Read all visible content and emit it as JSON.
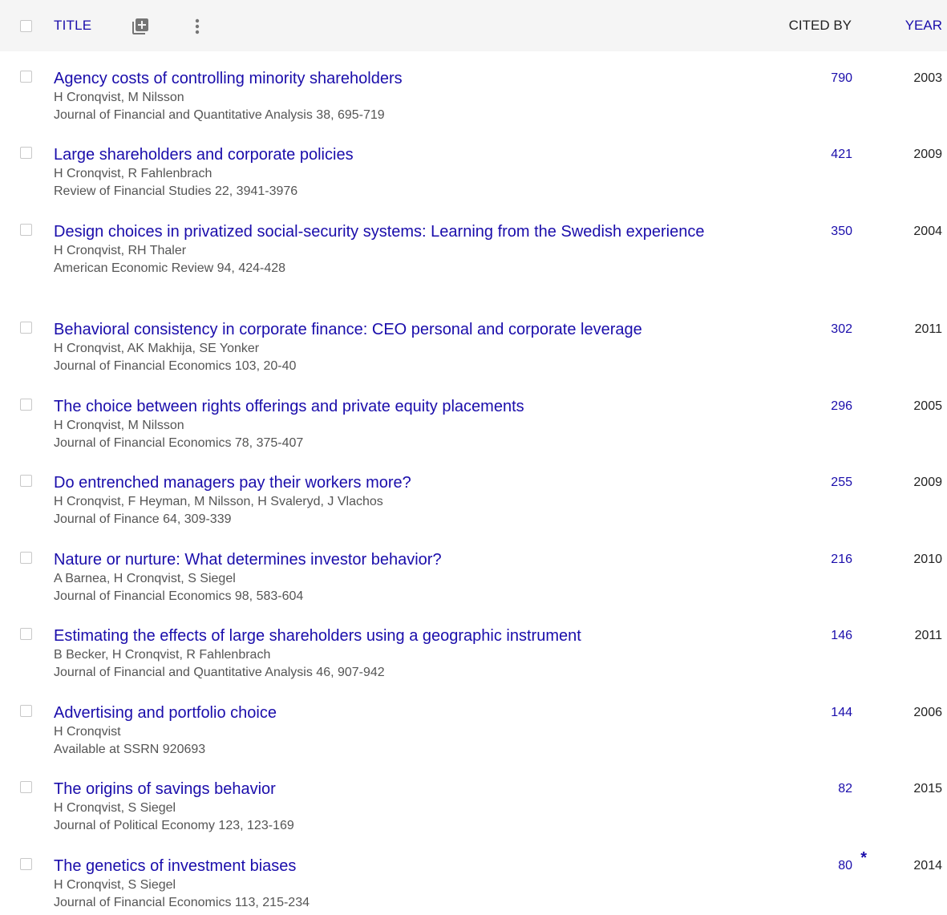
{
  "header": {
    "title_label": "TITLE",
    "cited_by_label": "CITED BY",
    "year_label": "YEAR",
    "icons": [
      "add-to-library-icon",
      "more-vert-icon"
    ]
  },
  "colors": {
    "link": "#1a0dab",
    "meta_text": "#555555",
    "header_bg": "#f5f5f5"
  },
  "articles": [
    {
      "title": "Agency costs of controlling minority shareholders",
      "authors": "H Cronqvist, M Nilsson",
      "venue": "Journal of Financial and Quantitative Analysis 38, 695-719",
      "cited_by": "790",
      "year": "2003",
      "star": ""
    },
    {
      "title": "Large shareholders and corporate policies",
      "authors": "H Cronqvist, R Fahlenbrach",
      "venue": "Review of Financial Studies 22, 3941-3976",
      "cited_by": "421",
      "year": "2009",
      "star": ""
    },
    {
      "title": "Design choices in privatized social-security systems: Learning from the Swedish experience",
      "authors": "H Cronqvist, RH Thaler",
      "venue": "American Economic Review 94, 424-428",
      "cited_by": "350",
      "year": "2004",
      "star": ""
    },
    {
      "title": "Behavioral consistency in corporate finance: CEO personal and corporate leverage",
      "authors": "H Cronqvist, AK Makhija, SE Yonker",
      "venue": "Journal of Financial Economics 103, 20-40",
      "cited_by": "302",
      "year": "2011",
      "star": ""
    },
    {
      "title": "The choice between rights offerings and private equity placements",
      "authors": "H Cronqvist, M Nilsson",
      "venue": "Journal of Financial Economics 78, 375-407",
      "cited_by": "296",
      "year": "2005",
      "star": ""
    },
    {
      "title": "Do entrenched managers pay their workers more?",
      "authors": "H Cronqvist, F Heyman, M Nilsson, H Svaleryd, J Vlachos",
      "venue": "Journal of Finance 64, 309-339",
      "cited_by": "255",
      "year": "2009",
      "star": ""
    },
    {
      "title": "Nature or nurture: What determines investor behavior?",
      "authors": "A Barnea, H Cronqvist, S Siegel",
      "venue": "Journal of Financial Economics 98, 583-604",
      "cited_by": "216",
      "year": "2010",
      "star": ""
    },
    {
      "title": "Estimating the effects of large shareholders using a geographic instrument",
      "authors": "B Becker, H Cronqvist, R Fahlenbrach",
      "venue": "Journal of Financial and Quantitative Analysis 46, 907-942",
      "cited_by": "146",
      "year": "2011",
      "star": ""
    },
    {
      "title": "Advertising and portfolio choice",
      "authors": "H Cronqvist",
      "venue": "Available at SSRN 920693",
      "cited_by": "144",
      "year": "2006",
      "star": ""
    },
    {
      "title": "The origins of savings behavior",
      "authors": "H Cronqvist, S Siegel",
      "venue": "Journal of Political Economy 123, 123-169",
      "cited_by": "82",
      "year": "2015",
      "star": ""
    },
    {
      "title": "The genetics of investment biases",
      "authors": "H Cronqvist, S Siegel",
      "venue": "Journal of Financial Economics 113, 215-234",
      "cited_by": "80",
      "year": "2014",
      "star": "*"
    }
  ]
}
